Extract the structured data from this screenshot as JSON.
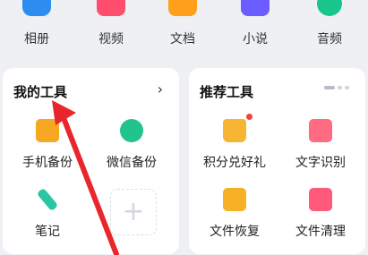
{
  "categories": [
    {
      "label": "相册",
      "icon": "album-icon"
    },
    {
      "label": "视频",
      "icon": "video-icon"
    },
    {
      "label": "文档",
      "icon": "document-icon"
    },
    {
      "label": "小说",
      "icon": "novel-icon"
    },
    {
      "label": "音频",
      "icon": "audio-icon"
    }
  ],
  "my_tools": {
    "title": "我的工具",
    "more_icon": "chevron-right-icon",
    "items": [
      {
        "label": "手机备份",
        "icon": "phone-backup-icon"
      },
      {
        "label": "微信备份",
        "icon": "wechat-backup-icon"
      },
      {
        "label": "笔记",
        "icon": "note-icon"
      }
    ],
    "add_icon": "plus-icon"
  },
  "recommended_tools": {
    "title": "推荐工具",
    "items": [
      {
        "label": "积分兑好礼",
        "icon": "gift-bag-icon"
      },
      {
        "label": "文字识别",
        "icon": "ocr-icon"
      },
      {
        "label": "文件恢复",
        "icon": "file-restore-icon"
      },
      {
        "label": "文件清理",
        "icon": "file-clean-icon"
      }
    ]
  },
  "colors": {
    "background": "#eef0f4",
    "card": "#ffffff",
    "annotation_arrow": "#e8262b"
  }
}
